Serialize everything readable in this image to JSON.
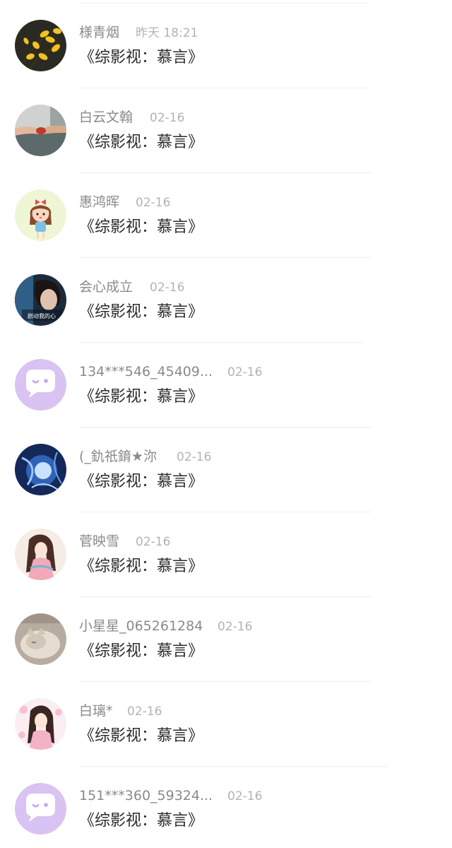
{
  "conversations": [
    {
      "name": "様青烟",
      "time": "昨天 18:21",
      "message": "《综影视：慕言》",
      "avatar": "avatar-flowers"
    },
    {
      "name": "白云文翰",
      "time": "02-16",
      "message": "《综影视：慕言》",
      "avatar": "avatar-hands"
    },
    {
      "name": "惠鸿晖",
      "time": "02-16",
      "message": "《综影视：慕言》",
      "avatar": "avatar-cartoon-girl"
    },
    {
      "name": "会心成立",
      "time": "02-16",
      "message": "《综影视：慕言》",
      "avatar": "avatar-man-photo",
      "avatar_caption": "剧动我的心"
    },
    {
      "name": "134***546_45409...",
      "time": "02-16",
      "message": "《综影视：慕言》",
      "avatar": "avatar-default-chat"
    },
    {
      "name": "(_釚祇錥★沵",
      "time": "02-16",
      "message": "《综影视：慕言》",
      "avatar": "avatar-blue-swirl"
    },
    {
      "name": "菅映雪",
      "time": "02-16",
      "message": "《综影视：慕言》",
      "avatar": "avatar-anime-girl"
    },
    {
      "name": "小星星_065261284",
      "time": "02-16",
      "message": "《综影视：慕言》",
      "avatar": "avatar-cat"
    },
    {
      "name": "白璃*",
      "time": "02-16",
      "message": "《综影视：慕言》",
      "avatar": "avatar-anime-girl-pink"
    },
    {
      "name": "151***360_59324...",
      "time": "02-16",
      "message": "《综影视：慕言》",
      "avatar": "avatar-default-chat"
    }
  ],
  "colors": {
    "default_avatar_bg": "#d9c3f2",
    "name_text": "#8a8a8a",
    "time_text": "#b3b3b3",
    "message_text": "#2b2b2b"
  }
}
